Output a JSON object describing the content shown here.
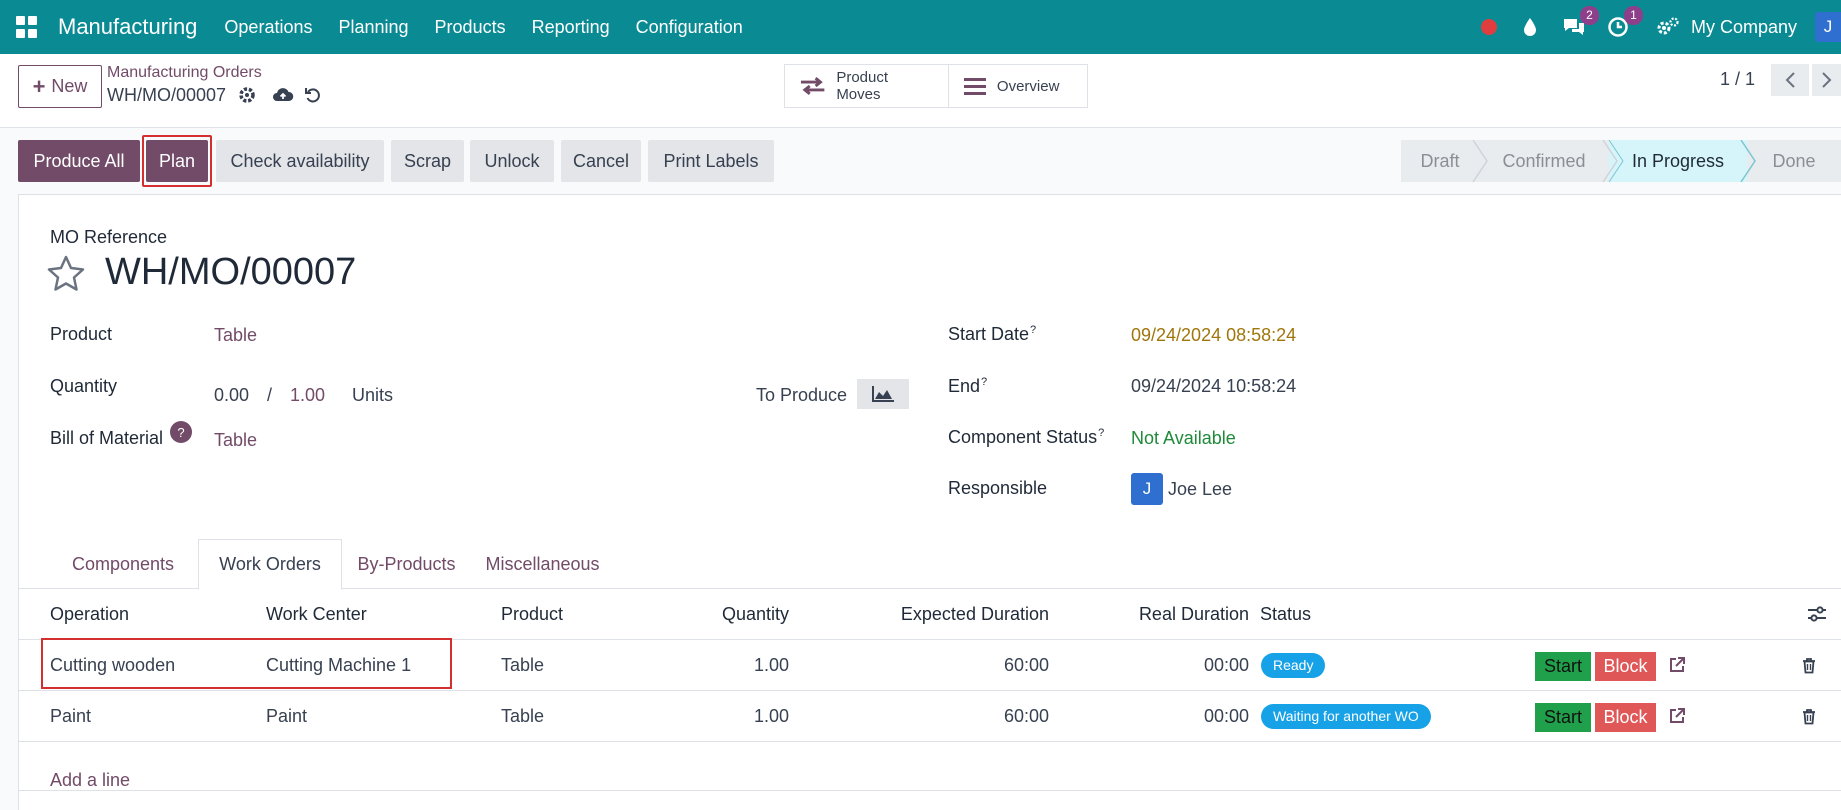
{
  "navbar": {
    "brand": "Manufacturing",
    "menu": [
      "Operations",
      "Planning",
      "Products",
      "Reporting",
      "Configuration"
    ],
    "chat_badge": "2",
    "activity_badge": "1",
    "company": "My Company",
    "user_initial": "J"
  },
  "control": {
    "new_label": "New",
    "breadcrumb": "Manufacturing Orders",
    "record_name": "WH/MO/00007",
    "smart_buttons": [
      "Product Moves",
      "Overview"
    ],
    "pager": "1 / 1"
  },
  "actions": {
    "produce_all": "Produce All",
    "plan": "Plan",
    "check_availability": "Check availability",
    "scrap": "Scrap",
    "unlock": "Unlock",
    "cancel": "Cancel",
    "print_labels": "Print Labels"
  },
  "stages": [
    "Draft",
    "Confirmed",
    "In Progress",
    "Done"
  ],
  "active_stage": "In Progress",
  "form": {
    "mo_reference_label": "MO Reference",
    "title": "WH/MO/00007",
    "product_label": "Product",
    "product_value": "Table",
    "quantity_label": "Quantity",
    "qty_produced": "0.00",
    "qty_separator": "/",
    "qty_to_produce": "1.00",
    "uom": "Units",
    "to_produce_label": "To Produce",
    "bom_label": "Bill of Material",
    "bom_help": "?",
    "bom_value": "Table",
    "start_date_label": "Start Date",
    "start_date_value": "09/24/2024 08:58:24",
    "end_label": "End",
    "end_value": "09/24/2024 10:58:24",
    "component_status_label": "Component Status",
    "component_status_value": "Not Available",
    "responsible_label": "Responsible",
    "responsible_initial": "J",
    "responsible_name": "Joe Lee",
    "help_mark": "?"
  },
  "tabs": [
    "Components",
    "Work Orders",
    "By-Products",
    "Miscellaneous"
  ],
  "active_tab": "Work Orders",
  "work_orders": {
    "columns": [
      "Operation",
      "Work Center",
      "Product",
      "Quantity",
      "Expected Duration",
      "Real Duration",
      "Status"
    ],
    "rows": [
      {
        "operation": "Cutting wooden",
        "work_center": "Cutting Machine 1",
        "product": "Table",
        "quantity": "1.00",
        "expected": "60:00",
        "real": "00:00",
        "status": "Ready"
      },
      {
        "operation": "Paint",
        "work_center": "Paint",
        "product": "Table",
        "quantity": "1.00",
        "expected": "60:00",
        "real": "00:00",
        "status": "Waiting for another WO"
      }
    ],
    "start_label": "Start",
    "block_label": "Block",
    "add_line": "Add a line"
  },
  "colors": {
    "navbar": "#0a8b94",
    "primary": "#714b67",
    "status_pill": "#17a2e8",
    "start_button": "#21a04b",
    "block_button": "#e05757",
    "start_date_text": "#a0760c",
    "not_available_text": "#1f8a3a",
    "highlight": "#d42f2f"
  },
  "icons": [
    "apps-icon",
    "record-dot-icon",
    "droplet-icon",
    "chat-icon",
    "clock-icon",
    "settings-icon",
    "gear-icon",
    "cloud-upload-icon",
    "undo-icon",
    "transfer-arrows-icon",
    "list-icon",
    "chevron-left-icon",
    "chevron-right-icon",
    "star-icon",
    "area-chart-icon",
    "sliders-icon",
    "external-link-icon",
    "trash-icon"
  ]
}
